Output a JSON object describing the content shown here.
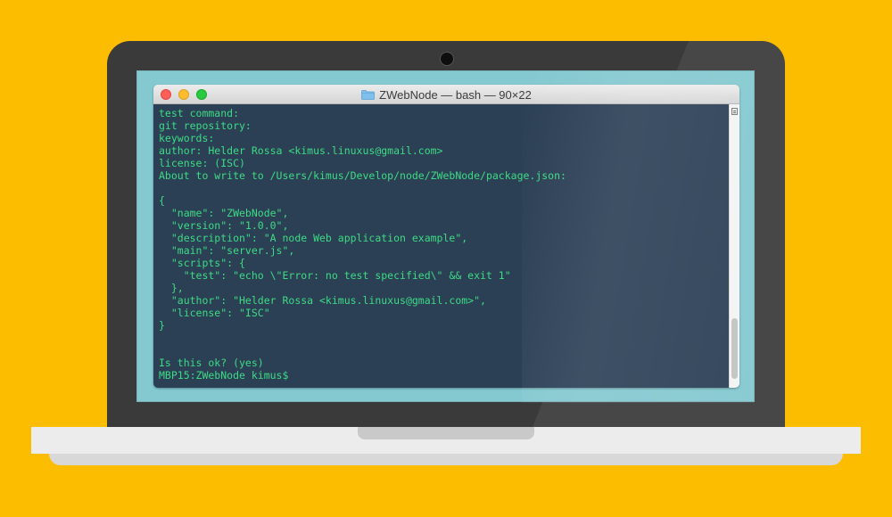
{
  "window": {
    "title": "ZWebNode — bash — 90×22",
    "folder_icon": "folder-icon",
    "colors": {
      "terminal_bg": "#2b3f55",
      "terminal_text": "#3ddc84",
      "background": "#fcbd00"
    }
  },
  "terminal": {
    "lines": [
      "test command:",
      "git repository:",
      "keywords:",
      "author: Helder Rossa <kimus.linuxus@gmail.com>",
      "license: (ISC)",
      "About to write to /Users/kimus/Develop/node/ZWebNode/package.json:",
      "",
      "{",
      "  \"name\": \"ZWebNode\",",
      "  \"version\": \"1.0.0\",",
      "  \"description\": \"A node Web application example\",",
      "  \"main\": \"server.js\",",
      "  \"scripts\": {",
      "    \"test\": \"echo \\\"Error: no test specified\\\" && exit 1\"",
      "  },",
      "  \"author\": \"Helder Rossa <kimus.linuxus@gmail.com>\",",
      "  \"license\": \"ISC\"",
      "}",
      "",
      "",
      "Is this ok? (yes)",
      "MBP15:ZWebNode kimus$"
    ]
  }
}
